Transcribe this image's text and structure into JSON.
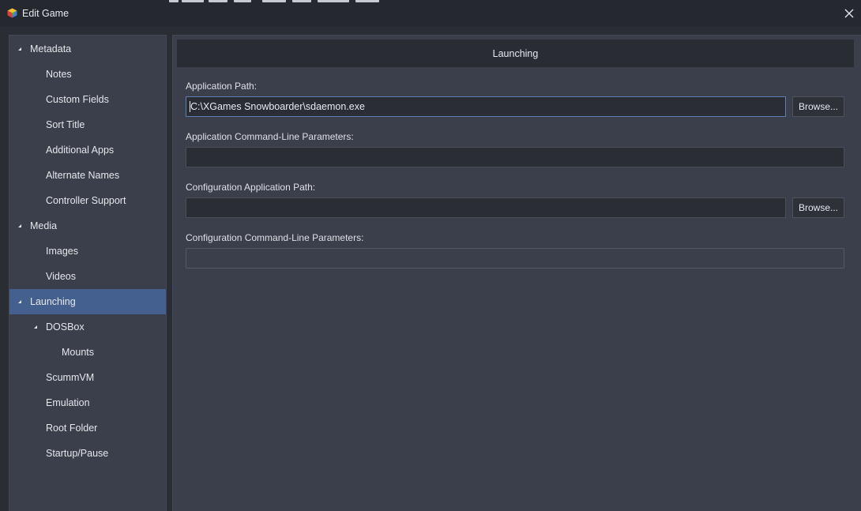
{
  "window": {
    "title": "Edit Game",
    "close_icon": "close-icon",
    "app_icon": "launchbox-cube-icon"
  },
  "sidebar": {
    "items": [
      {
        "label": "Metadata",
        "level": 0,
        "expanded": true,
        "selected": false
      },
      {
        "label": "Notes",
        "level": 1,
        "selected": false
      },
      {
        "label": "Custom Fields",
        "level": 1,
        "selected": false
      },
      {
        "label": "Sort Title",
        "level": 1,
        "selected": false
      },
      {
        "label": "Additional Apps",
        "level": 1,
        "selected": false
      },
      {
        "label": "Alternate Names",
        "level": 1,
        "selected": false
      },
      {
        "label": "Controller Support",
        "level": 1,
        "selected": false
      },
      {
        "label": "Media",
        "level": 0,
        "expanded": true,
        "selected": false
      },
      {
        "label": "Images",
        "level": 1,
        "selected": false
      },
      {
        "label": "Videos",
        "level": 1,
        "selected": false
      },
      {
        "label": "Launching",
        "level": 0,
        "expanded": true,
        "selected": true
      },
      {
        "label": "DOSBox",
        "level": 1,
        "expanded": true,
        "selected": false
      },
      {
        "label": "Mounts",
        "level": 2,
        "selected": false
      },
      {
        "label": "ScummVM",
        "level": 1,
        "selected": false
      },
      {
        "label": "Emulation",
        "level": 1,
        "selected": false
      },
      {
        "label": "Root Folder",
        "level": 1,
        "selected": false
      },
      {
        "label": "Startup/Pause",
        "level": 1,
        "selected": false
      }
    ]
  },
  "main": {
    "header": "Launching",
    "fields": {
      "app_path": {
        "label": "Application Path:",
        "value": "C:\\XGames Snowboarder\\sdaemon.exe",
        "browse_label": "Browse..."
      },
      "app_params": {
        "label": "Application Command-Line Parameters:",
        "value": ""
      },
      "config_path": {
        "label": "Configuration Application Path:",
        "value": "",
        "browse_label": "Browse..."
      },
      "config_params": {
        "label": "Configuration Command-Line Parameters:",
        "value": ""
      }
    }
  },
  "colors": {
    "background": "#2b2d35",
    "panel": "#3b3e4b",
    "selected": "#44608f",
    "focus_border": "#5a7fb5"
  }
}
